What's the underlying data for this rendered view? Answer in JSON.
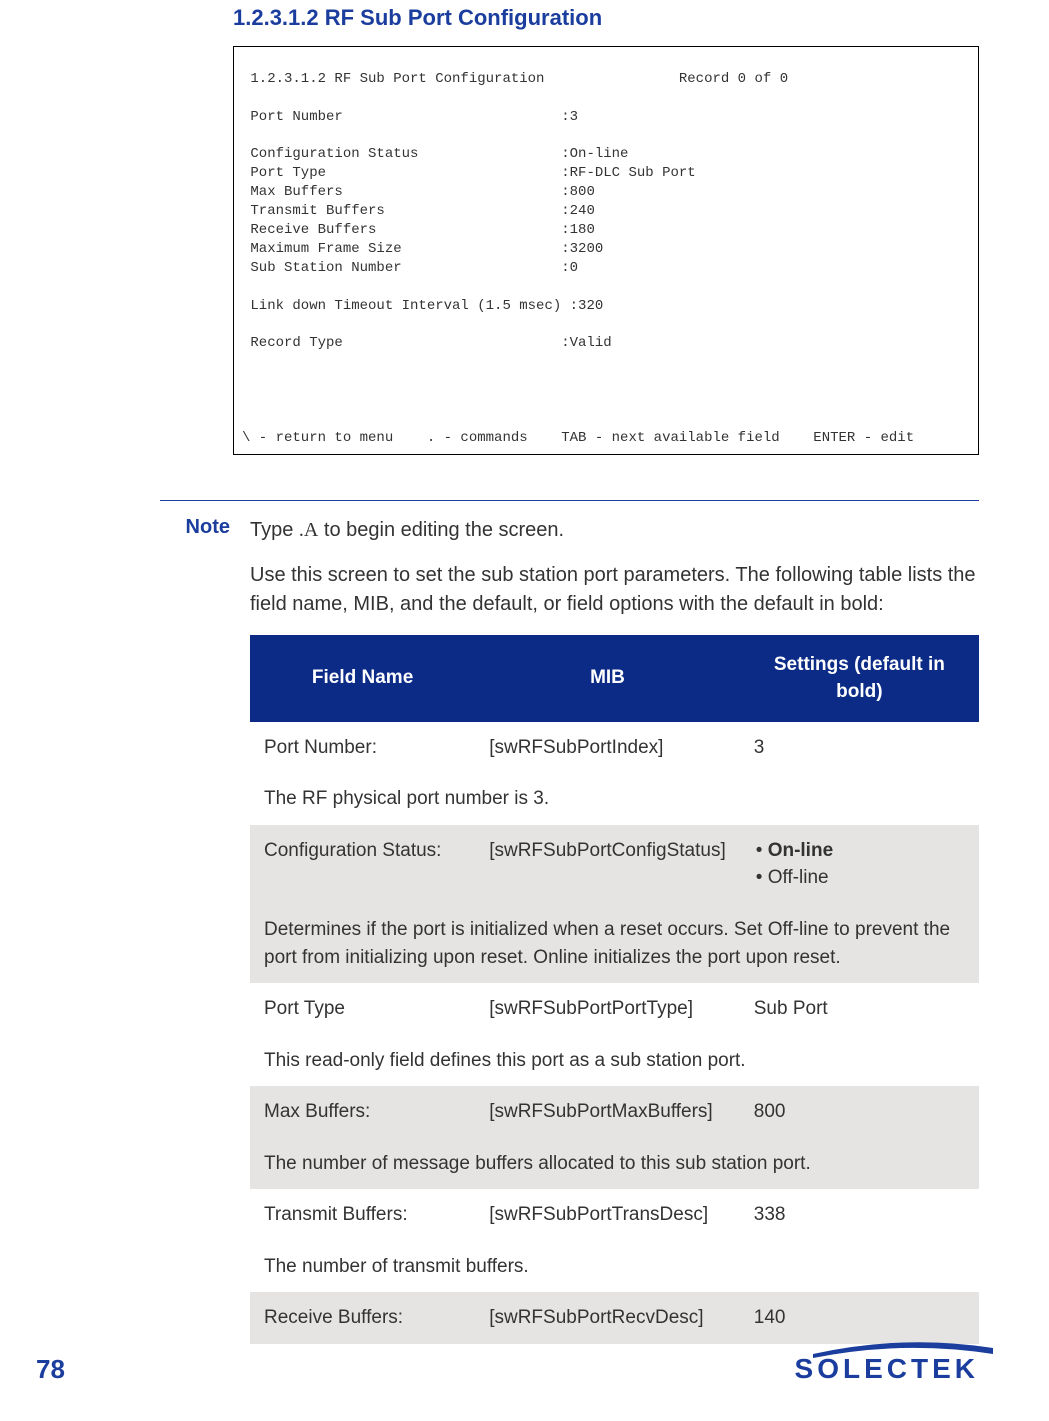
{
  "heading": "1.2.3.1.2 RF Sub Port Configuration",
  "terminal": {
    "title_line": " 1.2.3.1.2 RF Sub Port Configuration                Record 0 of 0",
    "fields": {
      "port_number": " Port Number                          :3",
      "config_status": " Configuration Status                 :On-line",
      "port_type": " Port Type                            :RF-DLC Sub Port",
      "max_buffers": " Max Buffers                          :800",
      "tx_buffers": " Transmit Buffers                     :240",
      "rx_buffers": " Receive Buffers                      :180",
      "max_frame": " Maximum Frame Size                   :3200",
      "sub_station": " Sub Station Number                   :0",
      "link_down": " Link down Timeout Interval (1.5 msec) :320",
      "record_type": " Record Type                          :Valid"
    },
    "nav_line": "\\ - return to menu    . - commands    TAB - next available field    ENTER - edit"
  },
  "note": {
    "label": "Note",
    "p1_prefix": "Type ",
    "p1_cmd": ".A",
    "p1_suffix": " to begin editing the screen.",
    "p2": "Use this screen to set the sub station port parameters. The following table lists the field name, MIB, and the default, or field options with the default in bold:"
  },
  "table": {
    "headers": {
      "field_name": "Field Name",
      "mib": "MIB",
      "settings": "Settings (default in bold)"
    },
    "rows": [
      {
        "shaded": false,
        "field": "Port Number:",
        "mib": "[swRFSubPortIndex]",
        "settings_text": "3",
        "desc": "The RF physical port number is 3."
      },
      {
        "shaded": true,
        "field": "Configuration Status:",
        "mib": "[swRFSubPortConfigStatus]",
        "settings_list": [
          {
            "text": "On-line",
            "bold": true
          },
          {
            "text": "Off-line",
            "bold": false
          }
        ],
        "desc": "Determines if the port is initialized when a reset occurs. Set Off-line to prevent the port from initializing upon reset.  Online initializes the port upon reset."
      },
      {
        "shaded": false,
        "field": "Port Type",
        "mib": "[swRFSubPortPortType]",
        "settings_text": "Sub Port",
        "desc": "This read-only field defines this port as a sub station port."
      },
      {
        "shaded": true,
        "field": "Max Buffers:",
        "mib": "[swRFSubPortMaxBuffers]",
        "settings_text": "800",
        "desc": "The number of message buffers allocated to this sub station port."
      },
      {
        "shaded": false,
        "field": "Transmit Buffers:",
        "mib": "[swRFSubPortTransDesc]",
        "settings_text": "338",
        "desc": "The number of transmit buffers."
      },
      {
        "shaded": true,
        "field": "Receive Buffers:",
        "mib": "[swRFSubPortRecvDesc]",
        "settings_text": "140"
      }
    ]
  },
  "page_number": "78",
  "logo_text": "SOLECTEK"
}
